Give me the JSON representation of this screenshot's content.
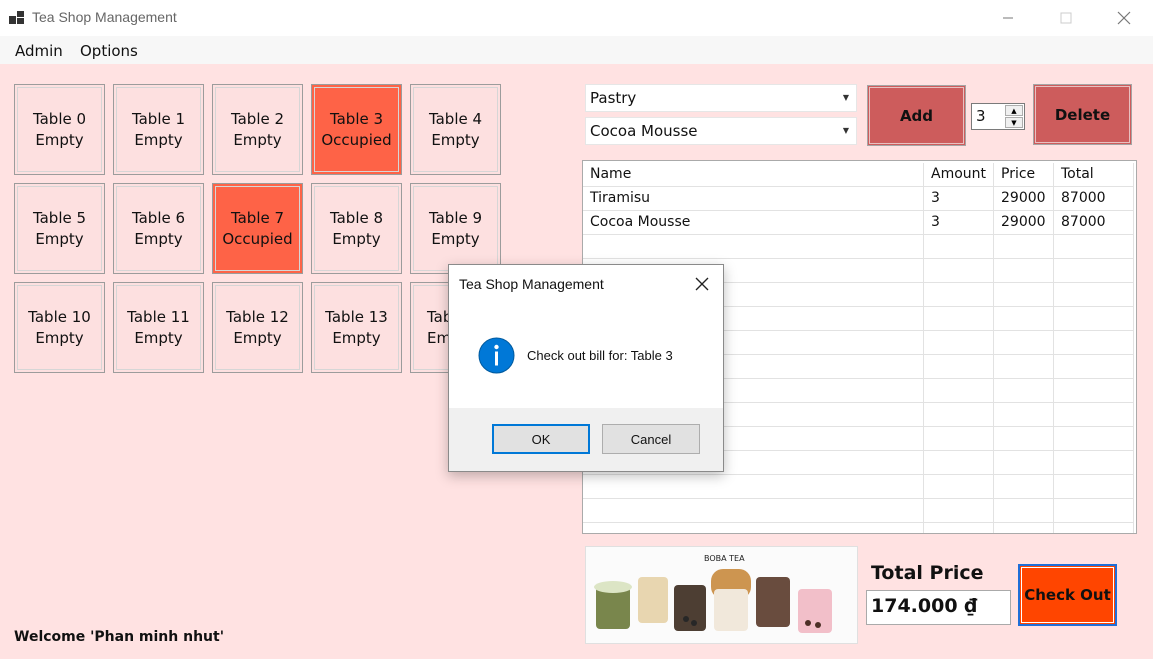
{
  "window": {
    "title": "Tea Shop Management"
  },
  "menu": {
    "items": [
      "Admin",
      "Options"
    ]
  },
  "tables": [
    {
      "name": "Table 0",
      "status": "Empty"
    },
    {
      "name": "Table 1",
      "status": "Empty"
    },
    {
      "name": "Table 2",
      "status": "Empty"
    },
    {
      "name": "Table 3",
      "status": "Occupied"
    },
    {
      "name": "Table 4",
      "status": "Empty"
    },
    {
      "name": "Table 5",
      "status": "Empty"
    },
    {
      "name": "Table 6",
      "status": "Empty"
    },
    {
      "name": "Table 7",
      "status": "Occupied"
    },
    {
      "name": "Table 8",
      "status": "Empty"
    },
    {
      "name": "Table 9",
      "status": "Empty"
    },
    {
      "name": "Table 10",
      "status": "Empty"
    },
    {
      "name": "Table 11",
      "status": "Empty"
    },
    {
      "name": "Table 12",
      "status": "Empty"
    },
    {
      "name": "Table 13",
      "status": "Empty"
    },
    {
      "name": "Tab",
      "status": "Em"
    }
  ],
  "order": {
    "category": "Pastry",
    "item": "Cocoa Mousse",
    "add_label": "Add",
    "quantity": "3",
    "delete_label": "Delete"
  },
  "bill": {
    "columns": [
      "Name",
      "Amount",
      "Price",
      "Total"
    ],
    "rows": [
      {
        "name": "Tiramisu",
        "amount": "3",
        "price": "29000",
        "total": "87000"
      },
      {
        "name": "Cocoa Mousse",
        "amount": "3",
        "price": "29000",
        "total": "87000"
      }
    ]
  },
  "banner": {
    "text": "BOBA TEA"
  },
  "total": {
    "label": "Total Price",
    "value": "174.000 ₫"
  },
  "checkout_label": "Check Out",
  "welcome": "Welcome 'Phan minh nhut'",
  "dialog": {
    "title": "Tea Shop Management",
    "message": "Check out bill for: Table 3",
    "ok_label": "OK",
    "cancel_label": "Cancel"
  },
  "colors": {
    "background": "#ffe2e2",
    "occupied": "#fe6347",
    "button_red": "#cd5c5c",
    "checkout": "#ff4500",
    "info": "#0078d7"
  }
}
